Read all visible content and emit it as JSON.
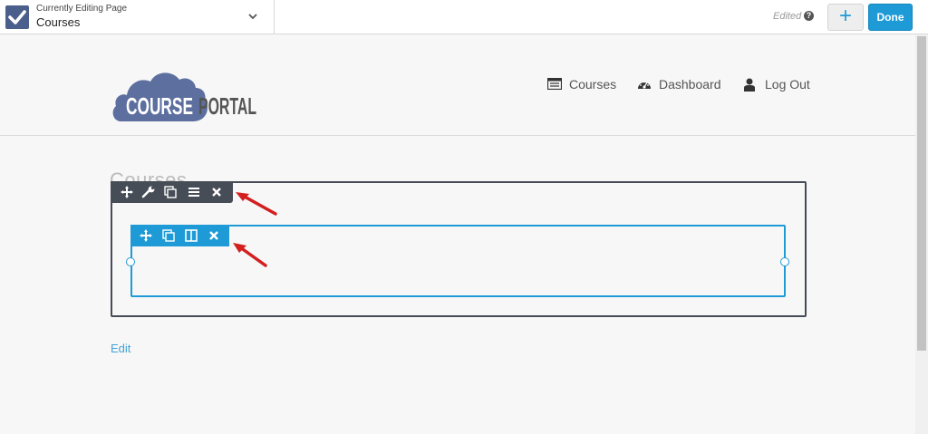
{
  "editor": {
    "caption": "Currently Editing Page",
    "page_name": "Courses",
    "status": "Edited",
    "add_label": "+",
    "done_label": "Done"
  },
  "site": {
    "logo_text_left": "COURSE",
    "logo_text_right": "PORTAL",
    "nav": [
      {
        "label": "Courses",
        "icon": "list-icon"
      },
      {
        "label": "Dashboard",
        "icon": "dashboard-icon"
      },
      {
        "label": "Log Out",
        "icon": "user-icon"
      }
    ]
  },
  "content": {
    "heading": "Courses",
    "edit_link": "Edit"
  },
  "row_toolbar": [
    "move-icon",
    "settings-icon",
    "duplicate-icon",
    "menu-icon",
    "remove-icon"
  ],
  "column_toolbar": [
    "move-icon",
    "duplicate-icon",
    "columns-icon",
    "remove-icon"
  ],
  "colors": {
    "accent": "#1e9bd7",
    "row_toolbar": "#474d57",
    "logo_cloud": "#5d6f9e",
    "annotation_arrow": "#d31f1f"
  }
}
